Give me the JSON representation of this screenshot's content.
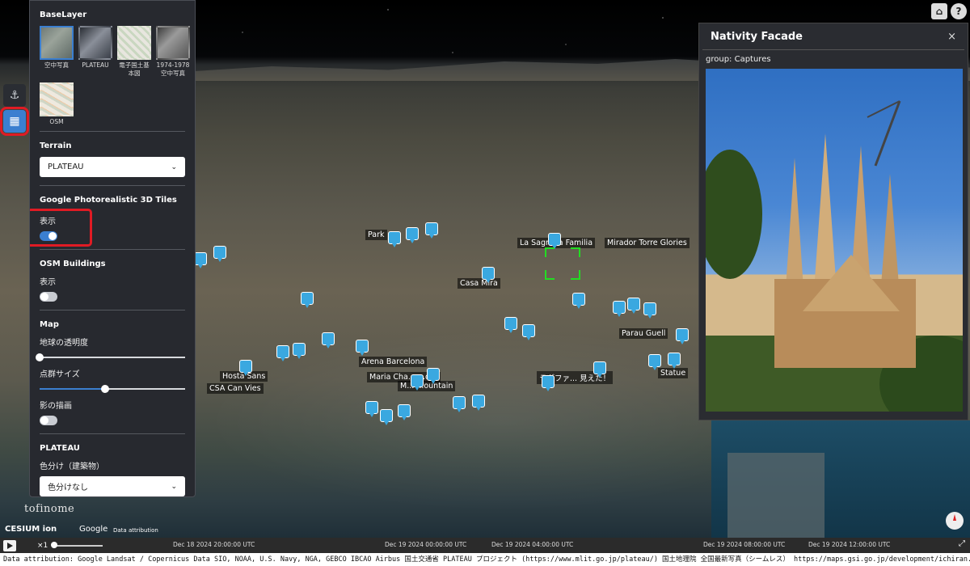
{
  "baselayer": {
    "title": "BaseLayer",
    "options": [
      {
        "label": "空中写真",
        "selected": true,
        "thumb": "aerial"
      },
      {
        "label": "PLATEAU",
        "selected": false,
        "thumb": "plateau"
      },
      {
        "label": "電子国土基本図",
        "selected": false,
        "thumb": "gsi"
      },
      {
        "label": "1974-1978空中写真",
        "selected": false,
        "thumb": "old"
      },
      {
        "label": "OSM",
        "selected": false,
        "thumb": "osm"
      }
    ]
  },
  "terrain": {
    "title": "Terrain",
    "value": "PLATEAU"
  },
  "google3d": {
    "title": "Google Photorealistic 3D Tiles",
    "toggle_label": "表示",
    "on": true
  },
  "osm_buildings": {
    "title": "OSM Buildings",
    "toggle_label": "表示",
    "on": false
  },
  "map": {
    "title": "Map",
    "earth_transparency_label": "地球の透明度",
    "earth_transparency_value": 0,
    "point_size_label": "点群サイズ",
    "point_size_value": 0.45,
    "shadow_label": "影の描画",
    "shadow_on": false
  },
  "plateau": {
    "title": "PLATEAU",
    "coloring_label": "色分け（建築物）",
    "coloring_value": "色分けなし"
  },
  "info_panel": {
    "title": "Nativity Facade",
    "group": "group: Captures",
    "close": "×"
  },
  "map_labels": [
    {
      "text": "Park"
    },
    {
      "text": "La Sagrada Familia"
    },
    {
      "text": "Mirador Torre Glories"
    },
    {
      "text": "Casa Mira"
    },
    {
      "text": "Parau Guell"
    },
    {
      "text": "Arena Barcelona"
    },
    {
      "text": "Maria Cha... ...ont"
    },
    {
      "text": "Hosta Sans"
    },
    {
      "text": "CSA Can Vies"
    },
    {
      "text": "M... ...ountain"
    },
    {
      "text": "ラダファ... 見えた！"
    },
    {
      "text": "Statue"
    }
  ],
  "timeline": {
    "speed": "×1",
    "ticks": [
      "Dec 18 2024 20:00:00 UTC",
      "Dec 19 2024 00:00:00 UTC",
      "Dec 19 2024 04:00:00 UTC",
      "Dec 19 2024 08:00:00 UTC",
      "Dec 19 2024 12:00:00 UTC"
    ]
  },
  "attribution": "Data attribution:  Google Landsat / Copernicus Data SIO, NOAA, U.S. Navy, NGA, GEBCO IBCAO Airbus 国土交通省 PLATEAU プロジェクト (https://www.mlit.go.jp/plateau/) 国土地理院 全国最新写真（シームレス） https://maps.gsi.go.jp/development/ichiran.html TerraMetrics",
  "logos": {
    "app": "tofinome",
    "cesium": "CESIUM ion",
    "google": "Google",
    "data_attribution": "Data attribution"
  }
}
